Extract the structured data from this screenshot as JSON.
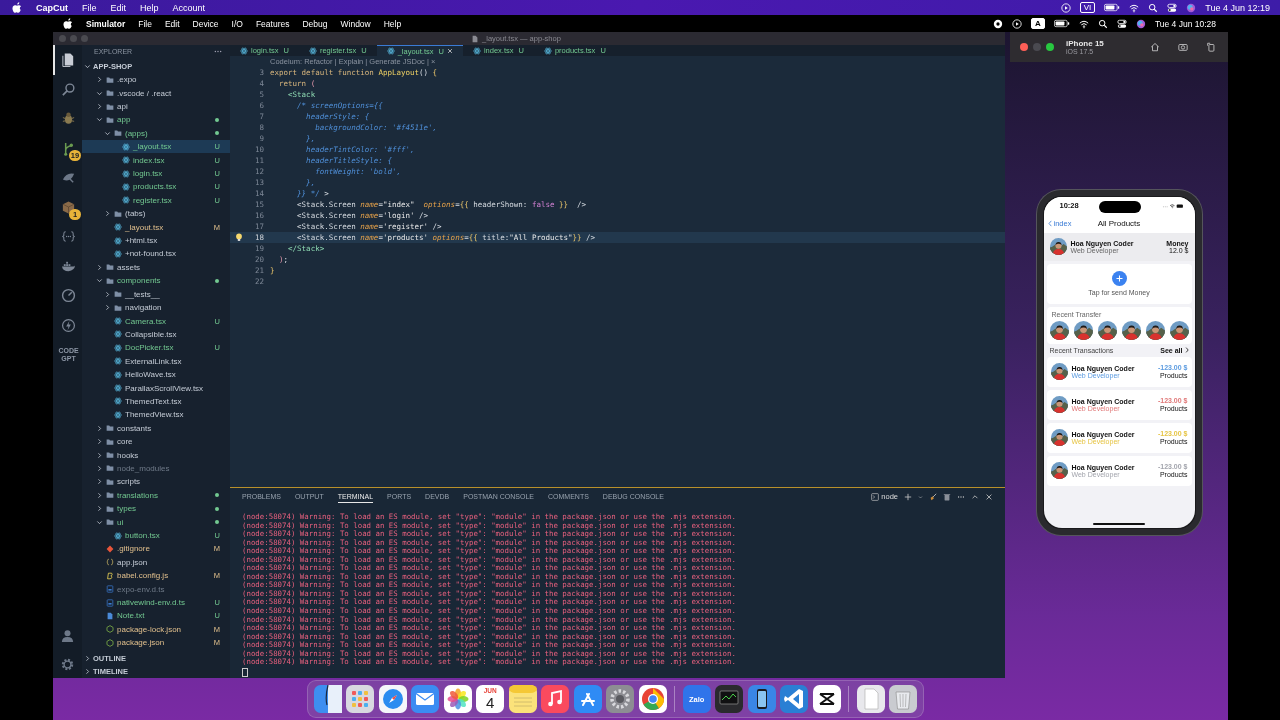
{
  "outer_menubar": {
    "app": "CapCut",
    "menus": [
      "File",
      "Edit",
      "Help",
      "Account"
    ],
    "input_label": "VI",
    "clock": "Tue 4 Jun 12:19"
  },
  "inner_menubar": {
    "app": "Simulator",
    "menus": [
      "File",
      "Edit",
      "Device",
      "I/O",
      "Features",
      "Debug",
      "Window",
      "Help"
    ],
    "input_label": "A",
    "clock": "Tue 4 Jun 10:28"
  },
  "vscode": {
    "title": "_layout.tsx — app-shop",
    "tabs": [
      {
        "label": "login.tsx",
        "status": "U",
        "selected": false
      },
      {
        "label": "register.tsx",
        "status": "U",
        "selected": false
      },
      {
        "label": "_layout.tsx",
        "status": "U",
        "selected": true
      },
      {
        "label": "index.tsx",
        "status": "U",
        "selected": false
      },
      {
        "label": "products.tsx",
        "status": "U",
        "selected": false
      }
    ],
    "activity_bar": [
      {
        "kind": "files",
        "selected": true
      },
      {
        "kind": "search",
        "selected": false
      },
      {
        "kind": "bug",
        "selected": false
      },
      {
        "kind": "branch",
        "selected": false,
        "badge": "19"
      },
      {
        "kind": "dish",
        "selected": false
      },
      {
        "kind": "package",
        "selected": false,
        "badge": "1"
      },
      {
        "kind": "braces",
        "selected": false
      },
      {
        "kind": "whale",
        "selected": false
      },
      {
        "kind": "gauge",
        "selected": false
      },
      {
        "kind": "bolt",
        "selected": false
      },
      {
        "kind": "text",
        "selected": false,
        "label": "CODE GPT"
      }
    ],
    "sidebar": {
      "title": "EXPLORER",
      "root": {
        "label": "APP-SHOP",
        "expanded": true
      },
      "tree": [
        {
          "label": ".expo",
          "kind": "folder",
          "expanded": false,
          "untracked": false,
          "modified": false,
          "ignored": false,
          "selected": false
        },
        {
          "label": ".vscode / .react",
          "kind": "folder",
          "expanded": true,
          "untracked": false,
          "modified": false,
          "ignored": false,
          "selected": false
        },
        {
          "label": "api",
          "kind": "folder",
          "expanded": false,
          "untracked": false,
          "modified": false,
          "ignored": false,
          "selected": false
        },
        {
          "label": "app",
          "kind": "folder",
          "expanded": true,
          "untracked": true,
          "modified": false,
          "ignored": false,
          "selected": false,
          "children": [
            {
              "label": "(apps)",
              "kind": "folder",
              "expanded": true,
              "untracked": true,
              "modified": false,
              "ignored": false,
              "selected": false,
              "children": [
                {
                  "label": "_layout.tsx",
                  "kind": "react",
                  "untracked": true,
                  "modified": false,
                  "ignored": false,
                  "badge": "U",
                  "selected": true
                },
                {
                  "label": "index.tsx",
                  "kind": "react",
                  "untracked": true,
                  "modified": false,
                  "ignored": false,
                  "badge": "U",
                  "selected": false
                },
                {
                  "label": "login.tsx",
                  "kind": "react",
                  "untracked": true,
                  "modified": false,
                  "ignored": false,
                  "badge": "U",
                  "selected": false
                },
                {
                  "label": "products.tsx",
                  "kind": "react",
                  "untracked": true,
                  "modified": false,
                  "ignored": false,
                  "badge": "U",
                  "selected": false
                },
                {
                  "label": "register.tsx",
                  "kind": "react",
                  "untracked": true,
                  "modified": false,
                  "ignored": false,
                  "badge": "U",
                  "selected": false
                }
              ]
            },
            {
              "label": "(tabs)",
              "kind": "folder",
              "expanded": false,
              "untracked": false,
              "modified": false,
              "ignored": false,
              "selected": false
            },
            {
              "label": "_layout.tsx",
              "kind": "react",
              "untracked": false,
              "modified": true,
              "ignored": false,
              "badge": "M",
              "selected": false
            },
            {
              "label": "+html.tsx",
              "kind": "react",
              "untracked": false,
              "modified": false,
              "ignored": false,
              "selected": false
            },
            {
              "label": "+not-found.tsx",
              "kind": "react",
              "untracked": false,
              "modified": false,
              "ignored": false,
              "selected": false
            }
          ]
        },
        {
          "label": "assets",
          "kind": "folder",
          "expanded": false,
          "untracked": false,
          "modified": false,
          "ignored": false,
          "selected": false
        },
        {
          "label": "components",
          "kind": "folder",
          "expanded": true,
          "untracked": true,
          "modified": false,
          "ignored": false,
          "selected": false,
          "children": [
            {
              "label": "__tests__",
              "kind": "folder",
              "expanded": false,
              "untracked": false,
              "modified": false,
              "ignored": false,
              "selected": false
            },
            {
              "label": "navigation",
              "kind": "folder",
              "expanded": false,
              "untracked": false,
              "modified": false,
              "ignored": false,
              "selected": false
            },
            {
              "label": "Camera.tsx",
              "kind": "react",
              "untracked": true,
              "modified": false,
              "ignored": false,
              "badge": "U",
              "selected": false
            },
            {
              "label": "Collapsible.tsx",
              "kind": "react",
              "untracked": false,
              "modified": false,
              "ignored": false,
              "selected": false
            },
            {
              "label": "DocPicker.tsx",
              "kind": "react",
              "untracked": true,
              "modified": false,
              "ignored": false,
              "badge": "U",
              "selected": false
            },
            {
              "label": "ExternalLink.tsx",
              "kind": "react",
              "untracked": false,
              "modified": false,
              "ignored": false,
              "selected": false
            },
            {
              "label": "HelloWave.tsx",
              "kind": "react",
              "untracked": false,
              "modified": false,
              "ignored": false,
              "selected": false
            },
            {
              "label": "ParallaxScrollView.tsx",
              "kind": "react",
              "untracked": false,
              "modified": false,
              "ignored": false,
              "selected": false
            },
            {
              "label": "ThemedText.tsx",
              "kind": "react",
              "untracked": false,
              "modified": false,
              "ignored": false,
              "selected": false
            },
            {
              "label": "ThemedView.tsx",
              "kind": "react",
              "untracked": false,
              "modified": false,
              "ignored": false,
              "selected": false
            }
          ]
        },
        {
          "label": "constants",
          "kind": "folder",
          "expanded": false,
          "untracked": false,
          "modified": false,
          "ignored": false,
          "selected": false
        },
        {
          "label": "core",
          "kind": "folder",
          "expanded": false,
          "untracked": false,
          "modified": false,
          "ignored": false,
          "selected": false
        },
        {
          "label": "hooks",
          "kind": "folder",
          "expanded": false,
          "untracked": false,
          "modified": false,
          "ignored": false,
          "selected": false
        },
        {
          "label": "node_modules",
          "kind": "folder",
          "expanded": false,
          "untracked": false,
          "modified": false,
          "ignored": true,
          "selected": false
        },
        {
          "label": "scripts",
          "kind": "folder",
          "expanded": false,
          "untracked": false,
          "modified": false,
          "ignored": false,
          "selected": false
        },
        {
          "label": "translations",
          "kind": "folder",
          "expanded": false,
          "untracked": true,
          "modified": false,
          "ignored": false,
          "selected": false
        },
        {
          "label": "types",
          "kind": "folder",
          "expanded": false,
          "untracked": true,
          "modified": false,
          "ignored": false,
          "selected": false
        },
        {
          "label": "ui",
          "kind": "folder",
          "expanded": true,
          "untracked": true,
          "modified": false,
          "ignored": false,
          "selected": false,
          "children": [
            {
              "label": "button.tsx",
              "kind": "react",
              "untracked": true,
              "modified": false,
              "ignored": false,
              "badge": "U",
              "selected": false
            }
          ]
        },
        {
          "label": ".gitignore",
          "kind": "git",
          "untracked": false,
          "modified": true,
          "ignored": false,
          "badge": "M",
          "selected": false
        },
        {
          "label": "app.json",
          "kind": "json",
          "untracked": false,
          "modified": false,
          "ignored": false,
          "selected": false
        },
        {
          "label": "babel.config.js",
          "kind": "babel",
          "untracked": false,
          "modified": true,
          "ignored": false,
          "badge": "M",
          "selected": false
        },
        {
          "label": "expo-env.d.ts",
          "kind": "ts",
          "untracked": false,
          "modified": false,
          "ignored": true,
          "selected": false
        },
        {
          "label": "nativewind-env.d.ts",
          "kind": "ts",
          "untracked": true,
          "modified": false,
          "ignored": false,
          "badge": "U",
          "selected": false
        },
        {
          "label": "Note.txt",
          "kind": "text",
          "untracked": true,
          "modified": false,
          "ignored": false,
          "badge": "U",
          "selected": false
        },
        {
          "label": "package-lock.json",
          "kind": "npm",
          "untracked": false,
          "modified": true,
          "ignored": false,
          "badge": "M",
          "selected": false
        },
        {
          "label": "package.json",
          "kind": "npm",
          "untracked": false,
          "modified": true,
          "ignored": false,
          "badge": "M",
          "selected": false
        }
      ],
      "sections": [
        {
          "label": "OUTLINE",
          "expanded": false
        },
        {
          "label": "TIMELINE",
          "expanded": false
        }
      ]
    },
    "editor": {
      "codelens": "Codeium: Refactor | Explain | Generate JSDoc | ×",
      "lines": [
        {
          "number": "3",
          "current": false,
          "segments": [
            {
              "text": "export default function ",
              "kind": "keyword"
            },
            {
              "text": "AppLayout",
              "kind": "function"
            },
            {
              "text": "() ",
              "kind": "plain"
            },
            {
              "text": "{",
              "kind": "brace"
            }
          ]
        },
        {
          "number": "4",
          "current": false,
          "segments": [
            {
              "text": "  return ",
              "kind": "keyword"
            },
            {
              "text": "(",
              "kind": "paren"
            }
          ]
        },
        {
          "number": "5",
          "current": false,
          "segments": [
            {
              "text": "    <Stack",
              "kind": "tag"
            }
          ]
        },
        {
          "number": "6",
          "current": false,
          "segments": [
            {
              "text": "      /* screenOptions={{",
              "kind": "comment"
            }
          ]
        },
        {
          "number": "7",
          "current": false,
          "segments": [
            {
              "text": "        headerStyle: {",
              "kind": "comment"
            }
          ]
        },
        {
          "number": "8",
          "current": false,
          "segments": [
            {
              "text": "          backgroundColor: '#f4511e',",
              "kind": "comment"
            }
          ]
        },
        {
          "number": "9",
          "current": false,
          "segments": [
            {
              "text": "        },",
              "kind": "comment"
            }
          ]
        },
        {
          "number": "10",
          "current": false,
          "segments": [
            {
              "text": "        headerTintColor: '#fff',",
              "kind": "comment"
            }
          ]
        },
        {
          "number": "11",
          "current": false,
          "segments": [
            {
              "text": "        headerTitleStyle: {",
              "kind": "comment"
            }
          ]
        },
        {
          "number": "12",
          "current": false,
          "segments": [
            {
              "text": "          fontWeight: 'bold',",
              "kind": "comment"
            }
          ]
        },
        {
          "number": "13",
          "current": false,
          "segments": [
            {
              "text": "        },",
              "kind": "comment"
            }
          ]
        },
        {
          "number": "14",
          "current": false,
          "segments": [
            {
              "text": "      }} */",
              "kind": "comment"
            },
            {
              "text": " >",
              "kind": "plain"
            }
          ]
        },
        {
          "number": "15",
          "current": false,
          "segments": [
            {
              "text": "      <Stack.Screen ",
              "kind": "plain"
            },
            {
              "text": "name",
              "kind": "attr"
            },
            {
              "text": "=",
              "kind": "plain"
            },
            {
              "text": "\"index\"  ",
              "kind": "string"
            },
            {
              "text": "options",
              "kind": "attr"
            },
            {
              "text": "=",
              "kind": "plain"
            },
            {
              "text": "{{",
              "kind": "brace"
            },
            {
              "text": " headerShown: ",
              "kind": "plain"
            },
            {
              "text": "false",
              "kind": "bool"
            },
            {
              "text": " }}",
              "kind": "brace"
            },
            {
              "text": "  />",
              "kind": "plain"
            }
          ]
        },
        {
          "number": "16",
          "current": false,
          "segments": [
            {
              "text": "      <Stack.Screen ",
              "kind": "plain"
            },
            {
              "text": "name",
              "kind": "attr"
            },
            {
              "text": "=",
              "kind": "plain"
            },
            {
              "text": "'login'",
              "kind": "string"
            },
            {
              "text": " />",
              "kind": "plain"
            }
          ]
        },
        {
          "number": "17",
          "current": false,
          "segments": [
            {
              "text": "      <Stack.Screen ",
              "kind": "plain"
            },
            {
              "text": "name",
              "kind": "attr"
            },
            {
              "text": "=",
              "kind": "plain"
            },
            {
              "text": "'register'",
              "kind": "string"
            },
            {
              "text": " />",
              "kind": "plain"
            }
          ]
        },
        {
          "number": "18",
          "current": true,
          "segments": [
            {
              "text": "      <Stack.Screen ",
              "kind": "plain"
            },
            {
              "text": "name",
              "kind": "attr"
            },
            {
              "text": "=",
              "kind": "plain"
            },
            {
              "text": "'products' ",
              "kind": "string"
            },
            {
              "text": "options",
              "kind": "attr"
            },
            {
              "text": "=",
              "kind": "plain"
            },
            {
              "text": "{{",
              "kind": "brace"
            },
            {
              "text": " title:",
              "kind": "plain"
            },
            {
              "text": "\"All Products\"",
              "kind": "string"
            },
            {
              "text": "}}",
              "kind": "brace"
            },
            {
              "text": " />",
              "kind": "plain"
            }
          ]
        },
        {
          "number": "19",
          "current": false,
          "segments": [
            {
              "text": "    </Stack>",
              "kind": "tag"
            }
          ]
        },
        {
          "number": "20",
          "current": false,
          "segments": [
            {
              "text": "  )",
              "kind": "paren"
            },
            {
              "text": ";",
              "kind": "plain"
            }
          ]
        },
        {
          "number": "21",
          "current": false,
          "segments": [
            {
              "text": "}",
              "kind": "brace"
            }
          ]
        },
        {
          "number": "22",
          "current": false
        }
      ]
    },
    "panel": {
      "tabs": [
        {
          "label": "PROBLEMS",
          "selected": false
        },
        {
          "label": "OUTPUT",
          "selected": false
        },
        {
          "label": "TERMINAL",
          "selected": true
        },
        {
          "label": "PORTS",
          "selected": false
        },
        {
          "label": "DEVDB",
          "selected": false
        },
        {
          "label": "POSTMAN CONSOLE",
          "selected": false
        },
        {
          "label": "COMMENTS",
          "selected": false
        },
        {
          "label": "DEBUG CONSOLE",
          "selected": false
        }
      ],
      "shell": "node",
      "output": [
        "(node:58074) Warning: To load an ES module, set \"type\": \"module\" in the package.json or use the .mjs extension.",
        "(node:58074) Warning: To load an ES module, set \"type\": \"module\" in the package.json or use the .mjs extension.",
        "(node:58074) Warning: To load an ES module, set \"type\": \"module\" in the package.json or use the .mjs extension.",
        "(node:58074) Warning: To load an ES module, set \"type\": \"module\" in the package.json or use the .mjs extension.",
        "(node:58074) Warning: To load an ES module, set \"type\": \"module\" in the package.json or use the .mjs extension.",
        "(node:58074) Warning: To load an ES module, set \"type\": \"module\" in the package.json or use the .mjs extension.",
        "(node:58074) Warning: To load an ES module, set \"type\": \"module\" in the package.json or use the .mjs extension.",
        "(node:58074) Warning: To load an ES module, set \"type\": \"module\" in the package.json or use the .mjs extension.",
        "(node:58074) Warning: To load an ES module, set \"type\": \"module\" in the package.json or use the .mjs extension.",
        "(node:58074) Warning: To load an ES module, set \"type\": \"module\" in the package.json or use the .mjs extension.",
        "(node:58074) Warning: To load an ES module, set \"type\": \"module\" in the package.json or use the .mjs extension.",
        "(node:58074) Warning: To load an ES module, set \"type\": \"module\" in the package.json or use the .mjs extension.",
        "(node:58074) Warning: To load an ES module, set \"type\": \"module\" in the package.json or use the .mjs extension.",
        "(node:58074) Warning: To load an ES module, set \"type\": \"module\" in the package.json or use the .mjs extension.",
        "(node:58074) Warning: To load an ES module, set \"type\": \"module\" in the package.json or use the .mjs extension.",
        "(node:58074) Warning: To load an ES module, set \"type\": \"module\" in the package.json or use the .mjs extension.",
        "(node:58074) Warning: To load an ES module, set \"type\": \"module\" in the package.json or use the .mjs extension.",
        "(node:58074) Warning: To load an ES module, set \"type\": \"module\" in the package.json or use the .mjs extension."
      ]
    }
  },
  "simulator": {
    "device": "iPhone 15",
    "os": "iOS 17.5",
    "phone": {
      "time": "10:28",
      "back": "index",
      "title": "All Products",
      "profile": {
        "name": "Hoa Nguyen Coder",
        "role": "Web Developer",
        "money_label": "Money",
        "money": "12.0 $"
      },
      "send_label": "Tap for send Money",
      "recent_transfer": {
        "title": "Recent Transfer"
      },
      "transactions_title": "Recent Transactions",
      "see_all": "See all",
      "transactions": [
        {
          "name": "Hoa Nguyen Coder",
          "role": "Web Developer",
          "amount": "-123.00 $",
          "category": "Products",
          "color": "#5b9be0"
        },
        {
          "name": "Hoa Nguyen Coder",
          "role": "Web Developer",
          "amount": "-123.00 $",
          "category": "Products",
          "color": "#e07878"
        },
        {
          "name": "Hoa Nguyen Coder",
          "role": "Web Developer",
          "amount": "-123.00 $",
          "category": "Products",
          "color": "#e6c443"
        },
        {
          "name": "Hoa Nguyen Coder",
          "role": "Web Developer",
          "amount": "-123.00 $",
          "category": "Products",
          "color": "#a2a4ac"
        }
      ]
    }
  },
  "dock": [
    {
      "kind": "finder"
    },
    {
      "kind": "launchpad"
    },
    {
      "kind": "safari"
    },
    {
      "kind": "mail"
    },
    {
      "kind": "photos"
    },
    {
      "kind": "calendar",
      "month": "JUN",
      "day": "4"
    },
    {
      "kind": "notes"
    },
    {
      "kind": "music"
    },
    {
      "kind": "appstore"
    },
    {
      "kind": "settings"
    },
    {
      "kind": "chrome"
    },
    {
      "kind": "separator"
    },
    {
      "kind": "zalo",
      "label": "Zalo"
    },
    {
      "kind": "monitor"
    },
    {
      "kind": "simulator"
    },
    {
      "kind": "vscode"
    },
    {
      "kind": "capcut"
    },
    {
      "kind": "separator"
    },
    {
      "kind": "file"
    },
    {
      "kind": "trash"
    }
  ]
}
